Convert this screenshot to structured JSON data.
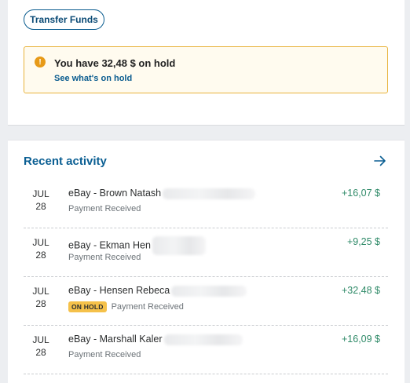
{
  "transfer": {
    "label": "Transfer Funds"
  },
  "hold": {
    "title": "You have 32,48 $ on hold",
    "link": "See what's on hold",
    "icon": "!"
  },
  "activity": {
    "title": "Recent activity",
    "rows": [
      {
        "month": "JUL",
        "day": "28",
        "name": "eBay - Brown Natash",
        "status": "Payment Received",
        "badge": "",
        "amount": "+16,07 $"
      },
      {
        "month": "JUL",
        "day": "28",
        "name": "eBay - Ekman Hen",
        "status": "Payment Received",
        "badge": "",
        "amount": "+9,25 $"
      },
      {
        "month": "JUL",
        "day": "28",
        "name": "eBay - Hensen Rebeca",
        "status": "Payment Received",
        "badge": "ON HOLD",
        "amount": "+32,48 $"
      },
      {
        "month": "JUL",
        "day": "28",
        "name": "eBay - Marshall Kaler",
        "status": "Payment Received",
        "badge": "",
        "amount": "+16,09 $"
      }
    ]
  },
  "colors": {
    "accent": "#0b5f93",
    "positive": "#2f8a68",
    "hold_border": "#e8b33c",
    "hold_badge": "#f5c14a"
  }
}
